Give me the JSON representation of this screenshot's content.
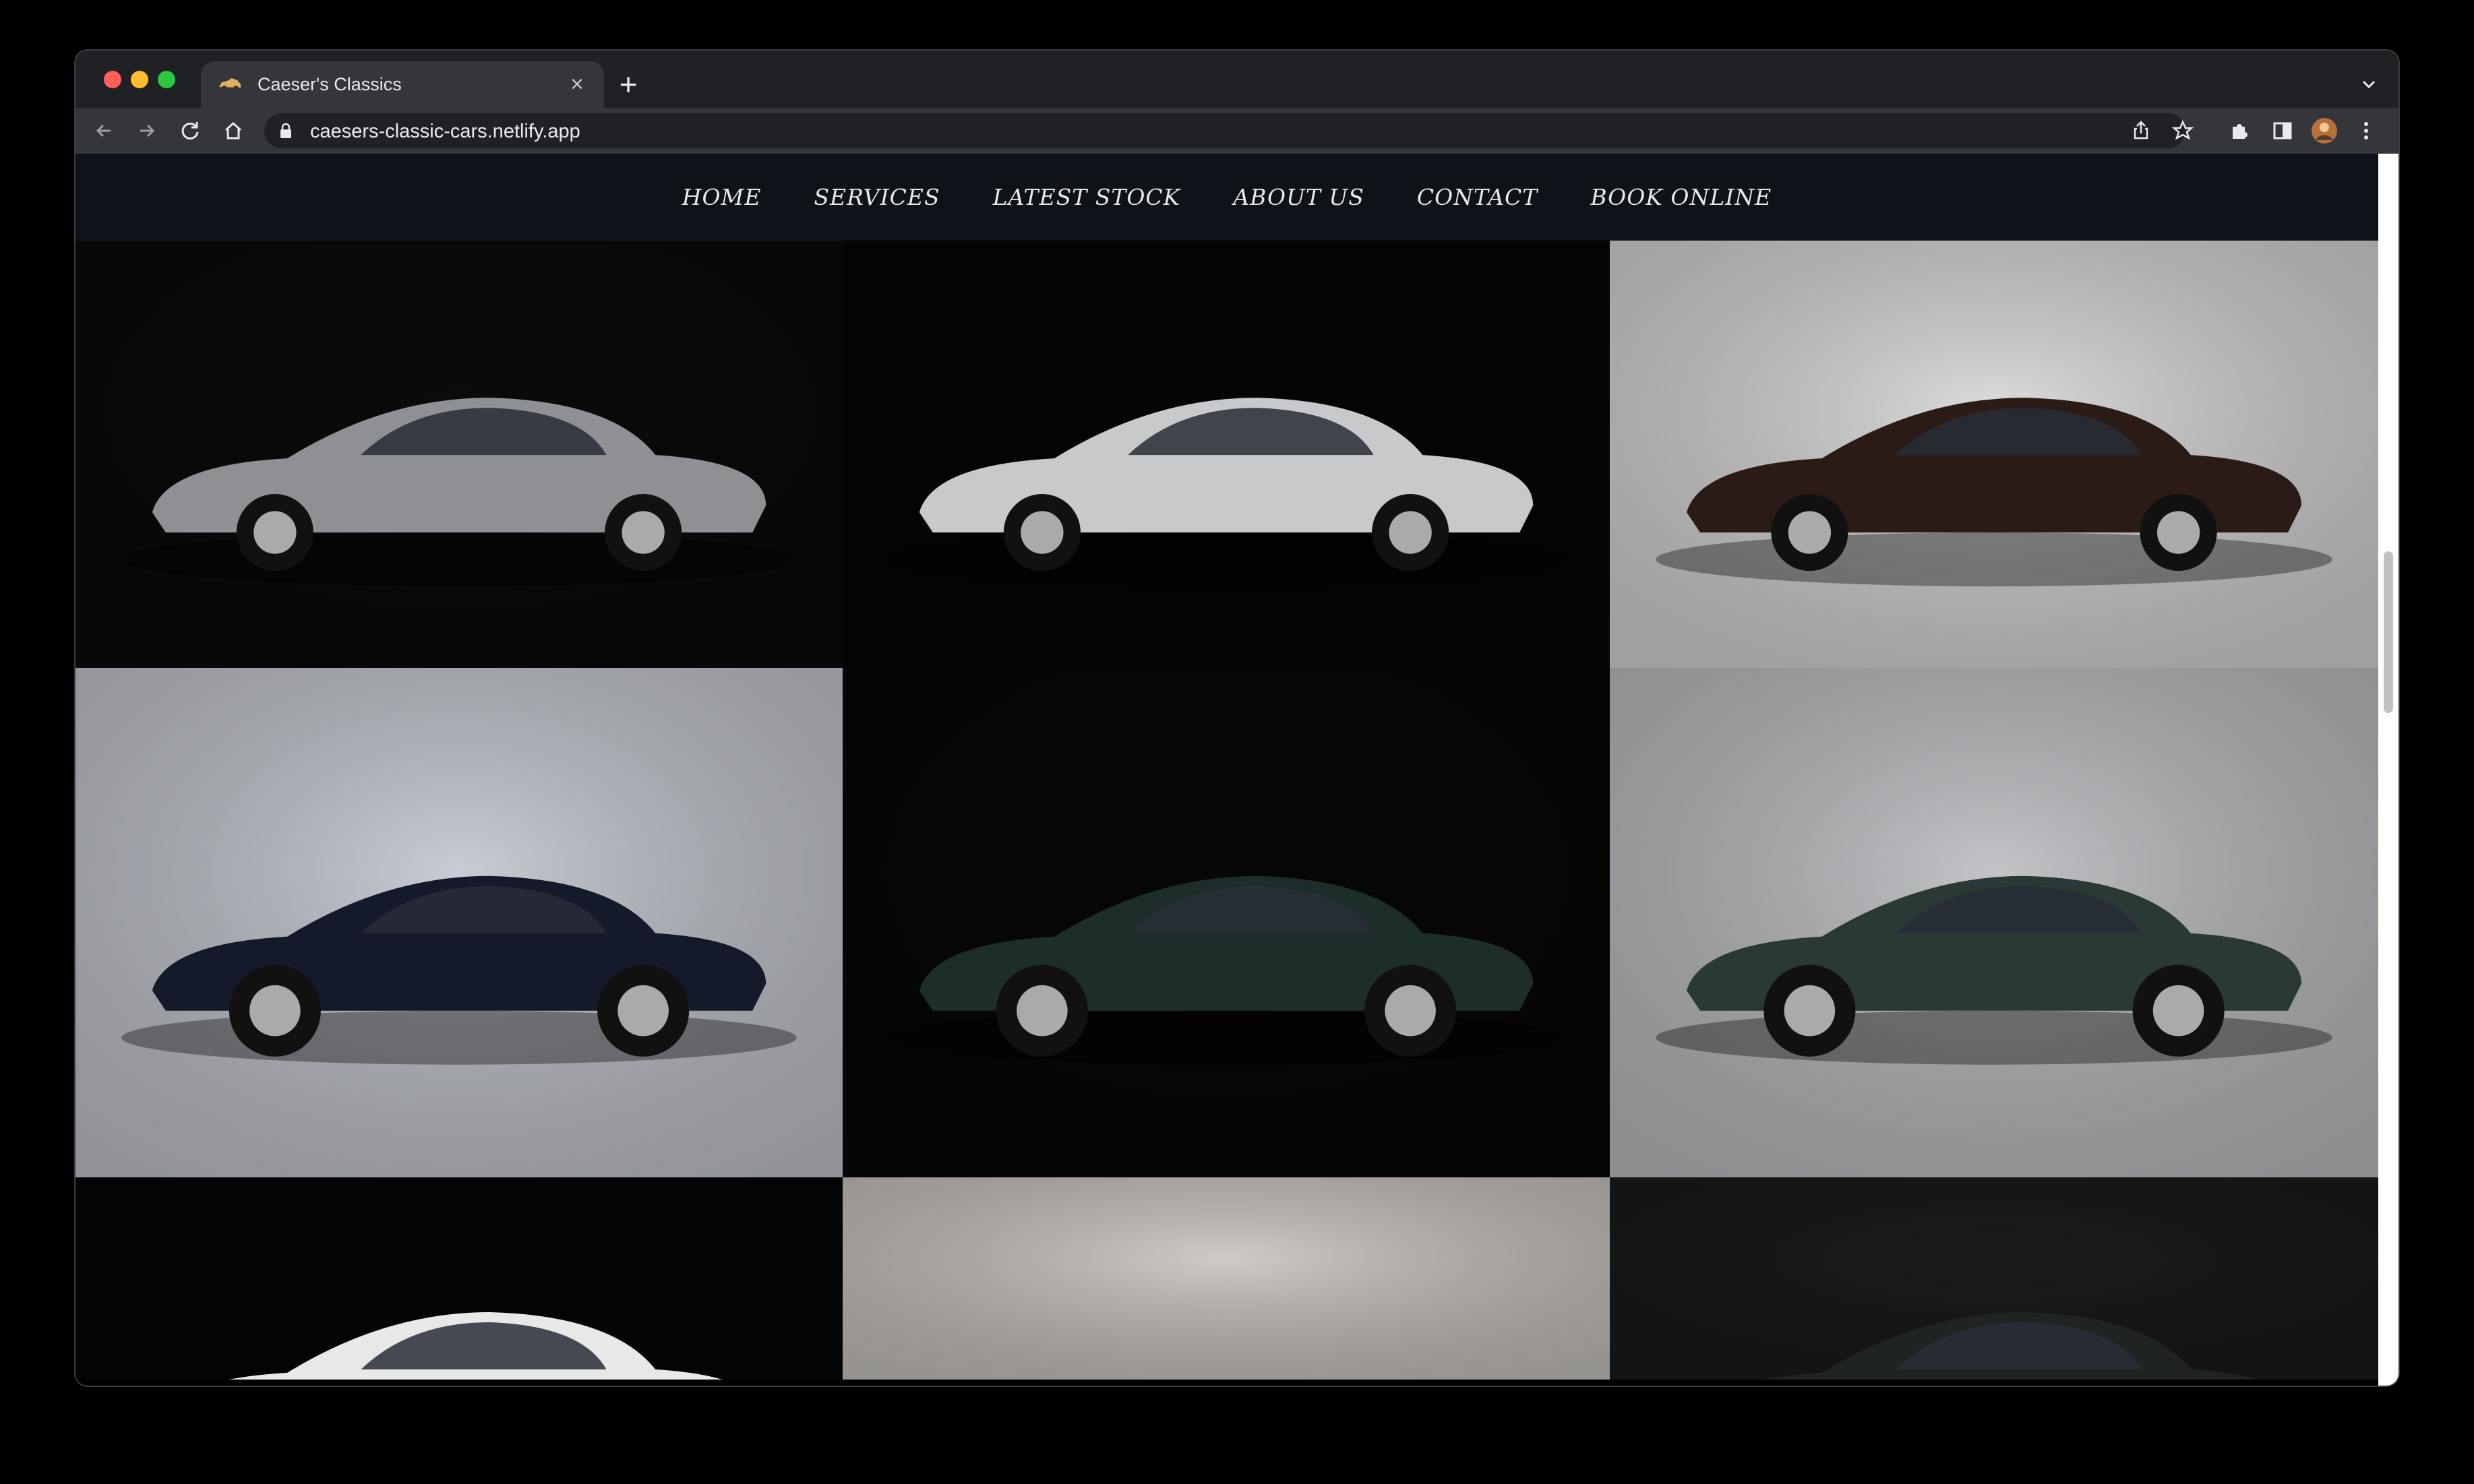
{
  "browser": {
    "tab_title": "Caeser's Classics",
    "url": "caesers-classic-cars.netlify.app"
  },
  "nav": {
    "items": [
      "HOME",
      "SERVICES",
      "LATEST STOCK",
      "ABOUT US",
      "CONTACT",
      "BOOK ONLINE"
    ]
  },
  "gallery": {
    "images": [
      {
        "name": "silver-gullwing-side-photo",
        "body": "#8e9093",
        "bg": "#0b0b0b"
      },
      {
        "name": "silver-gullwing-doors-open-photo",
        "body": "#c7c9cb",
        "bg": "#050505"
      },
      {
        "name": "dark-brown-pagoda-roadster-photo",
        "body": "#2b1b17",
        "bg": "#dcdcdc"
      },
      {
        "name": "navy-corvette-stingray-photo",
        "body": "#151a2a",
        "bg": "#c9ccd4"
      },
      {
        "name": "dark-green-miura-photo",
        "body": "#1d2e2a",
        "bg": "#070707"
      },
      {
        "name": "dark-green-e-type-photo",
        "body": "#2a3836",
        "bg": "#c2c4c7"
      },
      {
        "name": "white-coupe-photo",
        "body": "#e8e8e8",
        "bg": "#050505"
      },
      {
        "name": "plain-grey-studio-photo",
        "body": "#c9c5c0",
        "bg": "#cfcbc6"
      },
      {
        "name": "dark-coupe-photo",
        "body": "#1f2422",
        "bg": "#1b1b1b"
      }
    ]
  }
}
